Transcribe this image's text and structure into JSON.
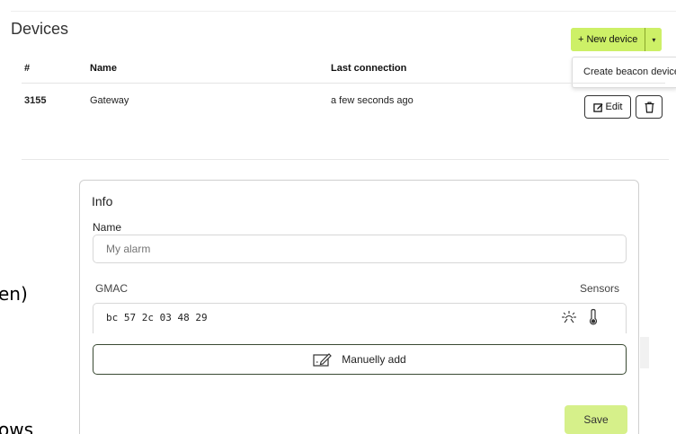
{
  "devices": {
    "title": "Devices",
    "new_device_label": "+ New device",
    "dropdown_caret": "▾",
    "dropdown_item": "Create beacon device",
    "columns": [
      "#",
      "Name",
      "Last connection"
    ],
    "rows": [
      {
        "id": "3155",
        "name": "Gateway",
        "last_connection": "a few seconds ago"
      }
    ],
    "edit_label": "Edit"
  },
  "fragments": {
    "top": "en)",
    "bottom": "ows"
  },
  "info": {
    "title": "Info",
    "name_label": "Name",
    "name_placeholder": "My alarm",
    "gmac_label": "GMAC",
    "sensors_label": "Sensors",
    "gmac_value": "bc 57 2c 03 48 29",
    "sensor_icons": [
      "light-icon",
      "thermometer-icon"
    ],
    "manual_add_label": "Manuelly add",
    "save_label": "Save"
  },
  "colors": {
    "accent": "#cdf067",
    "save": "#d6f08a"
  }
}
